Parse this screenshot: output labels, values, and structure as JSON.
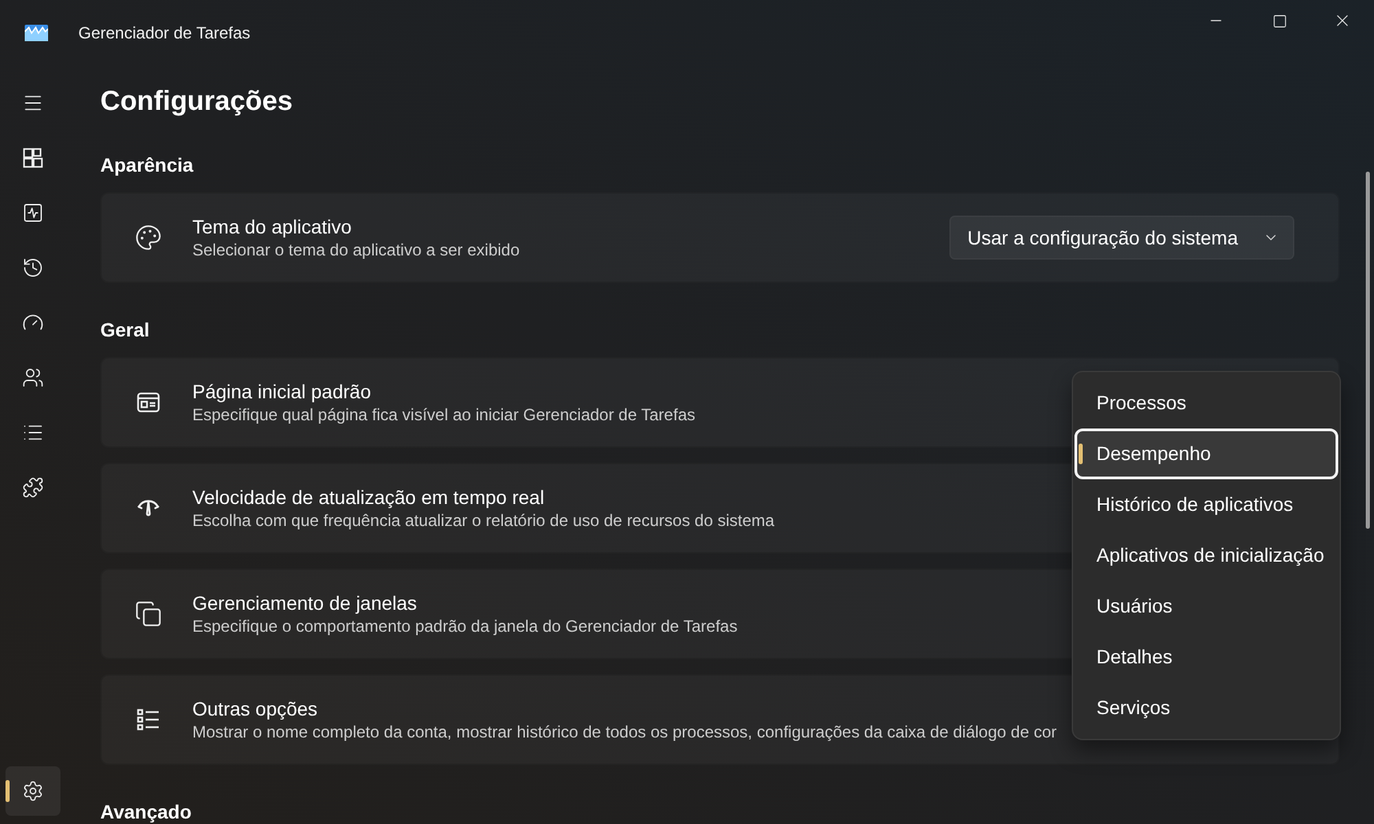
{
  "window": {
    "title": "Gerenciador de Tarefas"
  },
  "nav": {
    "items": [
      {
        "kind": "menu",
        "selected": false
      },
      {
        "kind": "processes",
        "selected": false
      },
      {
        "kind": "performance",
        "selected": false
      },
      {
        "kind": "history",
        "selected": false
      },
      {
        "kind": "startup",
        "selected": false
      },
      {
        "kind": "users",
        "selected": false
      },
      {
        "kind": "details",
        "selected": false
      },
      {
        "kind": "services",
        "selected": false
      }
    ],
    "footer_items": [
      {
        "kind": "settings",
        "selected": true
      }
    ]
  },
  "page": {
    "title": "Configurações",
    "sections": [
      {
        "heading": "Aparência",
        "settings": [
          {
            "kind": "theme",
            "title": "Tema do aplicativo",
            "description": "Selecionar o tema do aplicativo a ser exibido",
            "control": {
              "kind": "dropdown",
              "expanded": false,
              "value": "Usar a configuração do sistema"
            }
          }
        ]
      },
      {
        "heading": "Geral",
        "settings": [
          {
            "kind": "start-page",
            "title": "Página inicial padrão",
            "description": "Especifique qual página fica visível ao iniciar Gerenciador de Tarefas",
            "control": {
              "kind": "dropdown",
              "expanded": true,
              "options": [
                {
                  "label": "Processos",
                  "selected": false
                },
                {
                  "label": "Desempenho",
                  "selected": true
                },
                {
                  "label": "Histórico de aplicativos",
                  "selected": false
                },
                {
                  "label": "Aplicativos de inicialização",
                  "selected": false
                },
                {
                  "label": "Usuários",
                  "selected": false
                },
                {
                  "label": "Detalhes",
                  "selected": false
                },
                {
                  "label": "Serviços",
                  "selected": false
                }
              ]
            }
          },
          {
            "kind": "refresh-speed",
            "title": "Velocidade de atualização em tempo real",
            "description": "Escolha com que frequência atualizar o relatório de uso de recursos do sistema"
          },
          {
            "kind": "window-management",
            "title": "Gerenciamento de janelas",
            "description": "Especifique o comportamento padrão da janela do Gerenciador de Tarefas"
          },
          {
            "kind": "other-options",
            "title": "Outras opções",
            "description": "Mostrar o nome completo da conta, mostrar histórico de todos os processos, configurações da caixa de diálogo de cor"
          }
        ]
      },
      {
        "heading": "Avançado"
      }
    ]
  }
}
